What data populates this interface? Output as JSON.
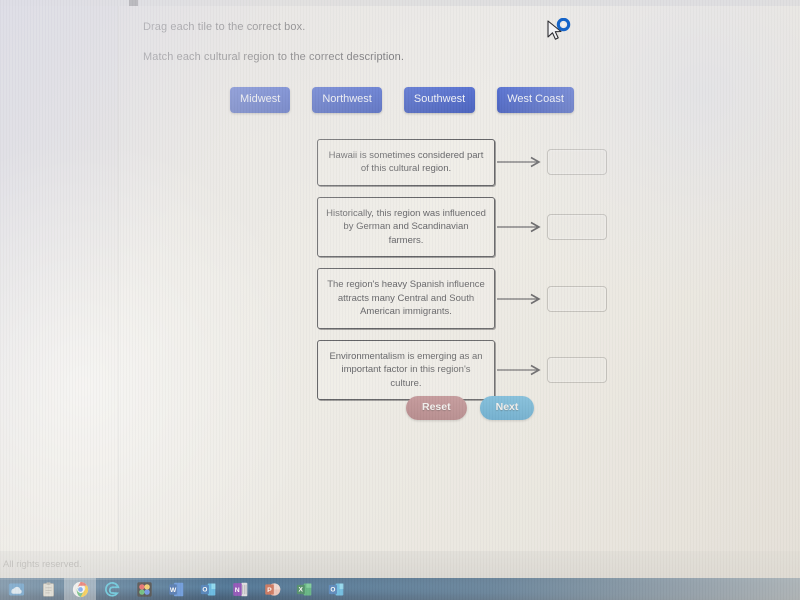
{
  "page": {
    "instruction_primary": "Drag each tile to the correct box.",
    "instruction_secondary": "Match each cultural region to the correct description.",
    "footer_text": "All rights reserved.",
    "background_color": "#e9e7e2"
  },
  "tiles": {
    "color": "#1b3cc0",
    "text_color": "#eef1fb",
    "items": [
      {
        "label": "Midwest"
      },
      {
        "label": "Northwest"
      },
      {
        "label": "Southwest"
      },
      {
        "label": "West Coast"
      }
    ]
  },
  "match_rows": [
    {
      "description": "Hawaii is sometimes considered part of this cultural region.",
      "arrow": "right-arrow-icon",
      "drop_value": ""
    },
    {
      "description": "Historically, this region was influenced by German and Scandinavian farmers.",
      "arrow": "right-arrow-icon",
      "drop_value": ""
    },
    {
      "description": "The region's heavy Spanish influence attracts many Central and South American immigrants.",
      "arrow": "right-arrow-icon",
      "drop_value": ""
    },
    {
      "description": "Environmentalism is emerging as an important factor in this region's culture.",
      "arrow": "right-arrow-icon",
      "drop_value": ""
    }
  ],
  "actions": {
    "reset_label": "Reset",
    "reset_color": "#a96d72",
    "next_label": "Next",
    "next_color": "#3d9fd0"
  },
  "cursor": {
    "name": "pointer-with-busy-ring",
    "ring_color": "#1463c8"
  },
  "taskbar": {
    "background_color": "#0e3358",
    "items": [
      {
        "name": "onedrive-icon",
        "active": false
      },
      {
        "name": "clipboard-icon",
        "active": false
      },
      {
        "name": "chrome-icon",
        "active": true
      },
      {
        "name": "edge-icon",
        "active": false
      },
      {
        "name": "puzzle-app-icon",
        "active": false
      },
      {
        "name": "word-icon",
        "active": false
      },
      {
        "name": "outlook-icon",
        "active": false
      },
      {
        "name": "onenote-icon",
        "active": false
      },
      {
        "name": "powerpoint-icon",
        "active": false
      },
      {
        "name": "excel-icon",
        "active": false
      },
      {
        "name": "outlook-secondary-icon",
        "active": false
      }
    ]
  }
}
